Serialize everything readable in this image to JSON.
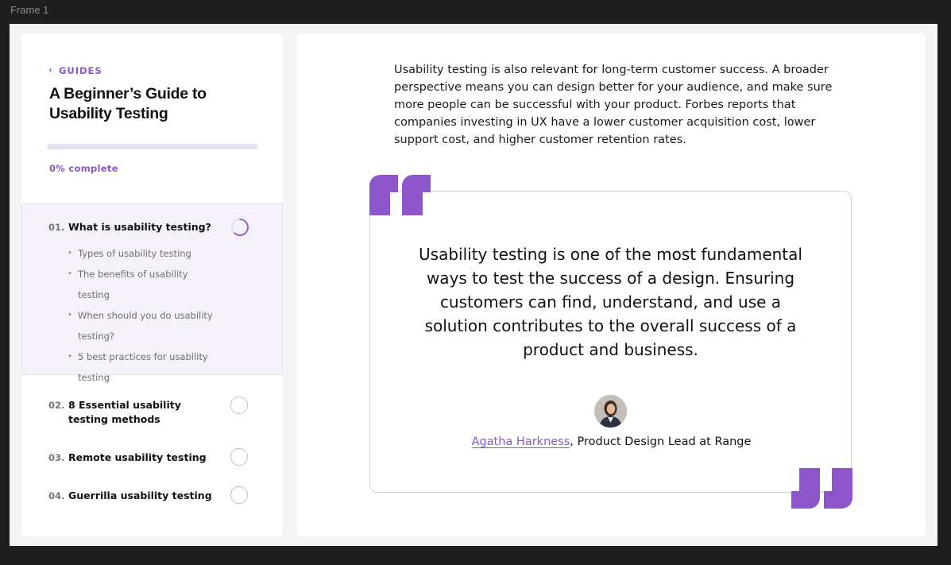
{
  "frame": {
    "label": "Frame 1"
  },
  "sidebar": {
    "back_label": "GUIDES",
    "guide_title": "A Beginner’s Guide to Usability Testing",
    "progress": {
      "fraction": 0,
      "label": "0% complete"
    },
    "sections": [
      {
        "num": "01.",
        "title": "What is usability testing?",
        "status": "in-progress",
        "subitems": [
          "Types of usability testing",
          "The benefits of usability testing",
          "When should you do usability testing?",
          "5 best practices for usability testing"
        ]
      },
      {
        "num": "02.",
        "title": "8 Essential usability testing methods",
        "status": "not-started"
      },
      {
        "num": "03.",
        "title": "Remote usability testing",
        "status": "not-started"
      },
      {
        "num": "04.",
        "title": "Guerrilla usability testing",
        "status": "not-started"
      }
    ]
  },
  "main": {
    "intro": "Usability testing is also relevant for long-term customer success. A broader perspective means you can design better for your audience, and make sure more people can be successful with your product. Forbes reports that companies investing in UX have a lower customer acquisition cost, lower support cost, and higher customer retention rates.",
    "quote": {
      "text": "Usability testing is one of the most fundamental ways to test the success of a design. Ensuring customers can find, understand, and use a solution contributes to the overall success of a product and business.",
      "author_name": "Agatha Harkness",
      "author_role": ", Product Design Lead at Range"
    }
  },
  "colors": {
    "accent": "#8c55c9",
    "progress_track": "#e8e1f5",
    "active_section_bg": "#f5f1fb",
    "page_bg": "#1e1e1e"
  },
  "icons": [
    "chevron-left-icon",
    "progress-ring-icon",
    "empty-circle-icon",
    "open-quote-icon",
    "close-quote-icon"
  ]
}
